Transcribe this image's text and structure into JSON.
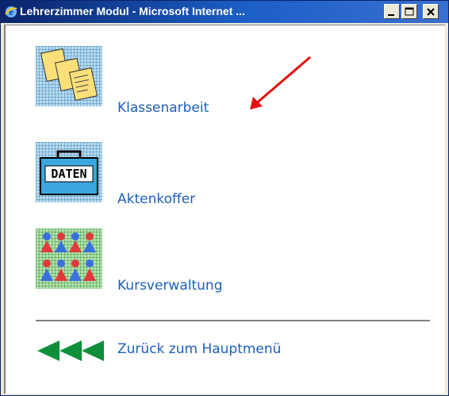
{
  "window": {
    "title": "Lehrerzimmer Modul - Microsoft Internet ...",
    "controls": {
      "minimize": "minimize-icon",
      "maximize": "maximize-icon",
      "close": "close-icon"
    }
  },
  "menu": {
    "items": [
      {
        "label": "Klassenarbeit",
        "icon": "documents-icon"
      },
      {
        "label": "Aktenkoffer",
        "icon": "briefcase-icon",
        "icon_text": "DATEN"
      },
      {
        "label": "Kursverwaltung",
        "icon": "people-icon"
      }
    ],
    "back_label": "Zurück zum Hauptmenü",
    "back_icon": "back-arrows-icon"
  },
  "colors": {
    "title_bar": "#0a246a",
    "link": "#1c5fb8",
    "back_arrows": "#0f8f3a",
    "annotation_arrow": "#e01010"
  }
}
